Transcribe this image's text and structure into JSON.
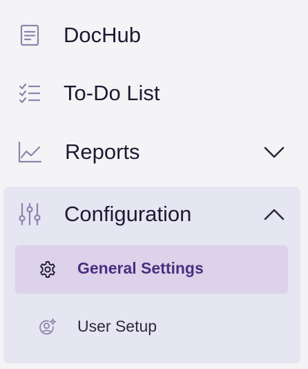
{
  "nav": {
    "items": [
      {
        "label": "DocHub",
        "icon": "document-icon"
      },
      {
        "label": "To-Do List",
        "icon": "checklist-icon"
      },
      {
        "label": "Reports",
        "icon": "line-chart-icon",
        "expanded": false
      },
      {
        "label": "Configuration",
        "icon": "sliders-icon",
        "expanded": true,
        "children": [
          {
            "label": "General Settings",
            "icon": "gear-icon",
            "active": true
          },
          {
            "label": "User Setup",
            "icon": "user-settings-icon",
            "active": false
          }
        ]
      }
    ]
  },
  "colors": {
    "background": "#f4f4f6",
    "group_background": "#e6e5f2",
    "active_background": "#dcd3ea",
    "active_text": "#4c2d80",
    "icon": "#8d82ad",
    "text": "#1d1a33"
  }
}
